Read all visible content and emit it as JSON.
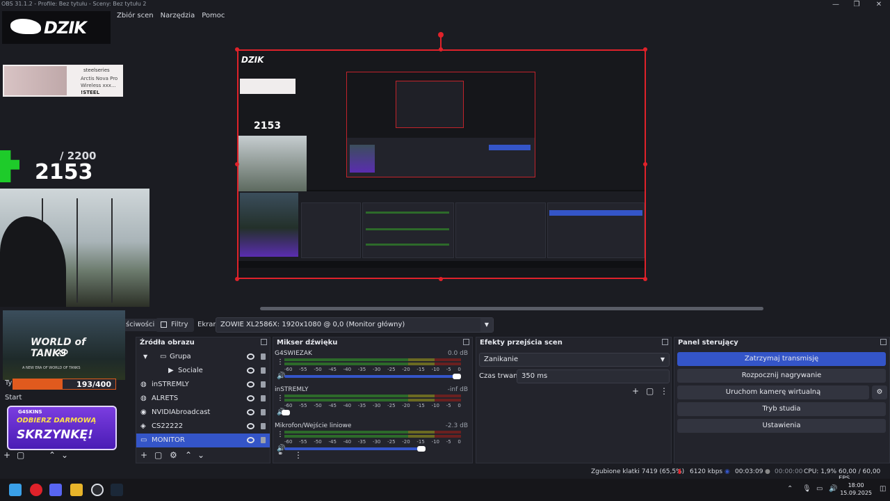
{
  "window": {
    "title": "OBS 31.1.2 - Profile: Bez tytułu - Sceny: Bez tytułu 2",
    "minimize": "—",
    "maximize": "❐",
    "close": "✕"
  },
  "menu": [
    "Zbiór scen",
    "Narzędzia",
    "Pomoc"
  ],
  "overlay": {
    "logo": "DZIK",
    "ad": {
      "brand": "steelseries",
      "product": "Arctis Nova Pro",
      "subtitle": "Wireless xxx...",
      "code": "!STEEL"
    },
    "counter": {
      "total": "/ 2200",
      "current": "2153"
    },
    "wot": {
      "title": "WORLD of TANKS",
      "version": "2.0",
      "tagline": "A NEW ERA OF WORLD OF TANKS"
    },
    "progress": {
      "label": "193/400",
      "fraction": 0.4825
    },
    "ty": "Ty",
    "start": "Start",
    "promo": {
      "tag": "G4SKINS",
      "line1": "ODBIERZ DARMOWĄ",
      "line2": "SKRZYNKĘ!"
    }
  },
  "toolbar": {
    "tab_partial": "ściwości",
    "filters": "Filtry",
    "screen_label": "Ekran",
    "screen_value": "ZOWIE XL2586X: 1920x1080 @ 0,0 (Monitor główny)"
  },
  "sources": {
    "title": "Źródła obrazu",
    "items": [
      {
        "label": "Grupa",
        "indent": 1,
        "icon": "folder-icon"
      },
      {
        "label": "Sociale",
        "indent": 2,
        "icon": "play-icon"
      },
      {
        "label": "inSTREMLY",
        "indent": 0,
        "icon": "globe-icon"
      },
      {
        "label": "ALRETS",
        "indent": 0,
        "icon": "globe-icon"
      },
      {
        "label": "NVIDIAbroadcast",
        "indent": 0,
        "icon": "camera-icon"
      },
      {
        "label": "CS22222",
        "indent": 0,
        "icon": "gamepad-icon"
      },
      {
        "label": "MONITOR",
        "indent": 0,
        "icon": "monitor-icon",
        "selected": true
      }
    ]
  },
  "mixer": {
    "title": "Mikser dźwięku",
    "ticks": [
      "-60",
      "-55",
      "-50",
      "-45",
      "-40",
      "-35",
      "-30",
      "-25",
      "-20",
      "-15",
      "-10",
      "-5",
      "0"
    ],
    "channels": [
      {
        "name": "G4SWIEZAK",
        "db": "0.0 dB",
        "level": 1.0
      },
      {
        "name": "inSTREMLY",
        "db": "-inf dB",
        "level": 0.03
      },
      {
        "name": "Mikrofon/Wejście liniowe",
        "db": "-2.3 dB",
        "level": 0.8
      }
    ]
  },
  "transitions": {
    "title": "Efekty przejścia scen",
    "selected": "Zanikanie",
    "duration_label": "Czas trwania",
    "duration_value": "350 ms"
  },
  "controls": {
    "title": "Panel sterujący",
    "buttons": [
      "Zatrzymaj transmisję",
      "Rozpocznij nagrywanie",
      "Uruchom kamerę wirtualną",
      "Tryb studia",
      "Ustawienia"
    ]
  },
  "status": {
    "dropped": "Zgubione klatki 7419 (65,5%)",
    "bitrate": "6120 kbps",
    "live_time": "00:03:09",
    "rec_time": "00:00:00",
    "cpu": "CPU: 1,9%",
    "fps": "60,00 / 60,00 FPS"
  },
  "taskbar": {
    "time": "18:00",
    "date": "15.09.2025"
  },
  "colors": {
    "accent": "#3455c8",
    "selection_red": "#e0222a",
    "panel": "#23242c"
  }
}
